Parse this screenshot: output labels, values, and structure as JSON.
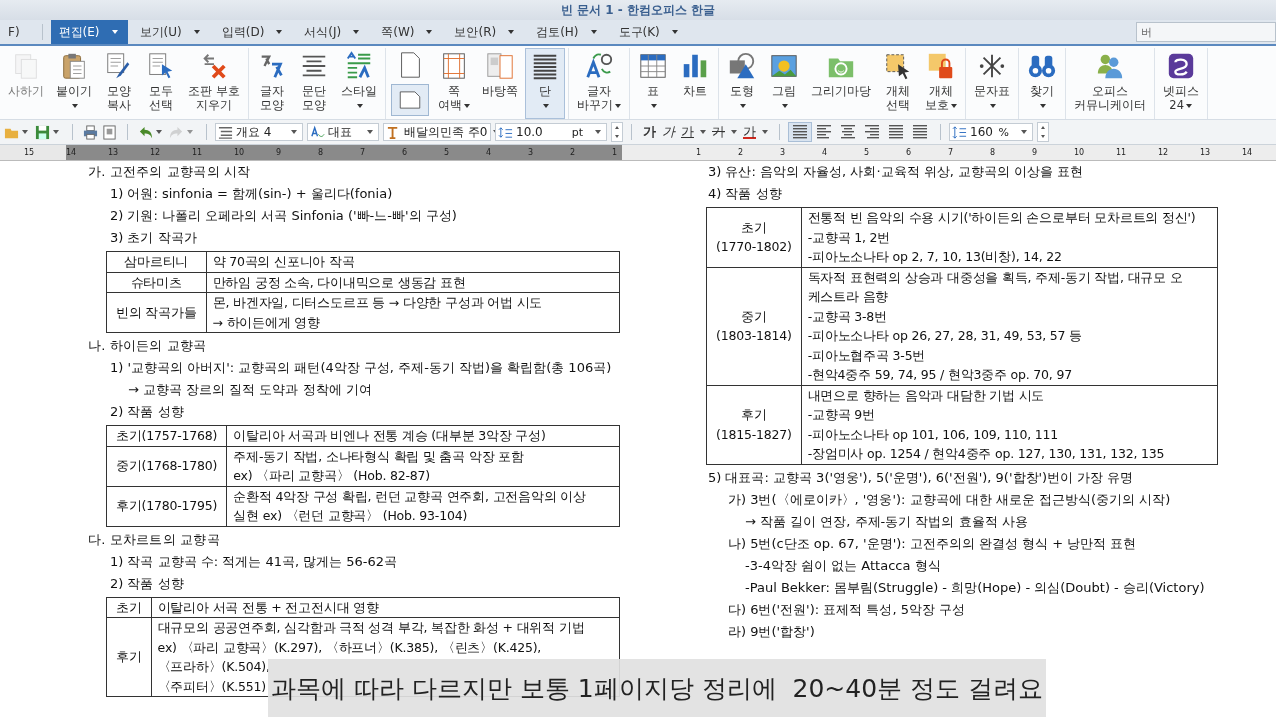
{
  "window": {
    "title": "빈 문서 1 - 한컴오피스 한글"
  },
  "menu_tabs": [
    {
      "label": "F)",
      "selected": false,
      "dropdown": false
    },
    {
      "label": "편집(E)",
      "selected": true,
      "dropdown": true
    },
    {
      "label": "보기(U)",
      "selected": false,
      "dropdown": true
    },
    {
      "label": "입력(D)",
      "selected": false,
      "dropdown": true
    },
    {
      "label": "서식(J)",
      "selected": false,
      "dropdown": true
    },
    {
      "label": "쪽(W)",
      "selected": false,
      "dropdown": true
    },
    {
      "label": "보안(R)",
      "selected": false,
      "dropdown": true
    },
    {
      "label": "검토(H)",
      "selected": false,
      "dropdown": true
    },
    {
      "label": "도구(K)",
      "selected": false,
      "dropdown": true
    }
  ],
  "search": {
    "value": "버"
  },
  "ribbon": [
    {
      "buttons": [
        {
          "kind": "copy",
          "label_lines": [
            "사하기"
          ],
          "selected": false,
          "disabled": true,
          "dropdown": false
        },
        {
          "kind": "paste",
          "label_lines": [
            "붙이기"
          ],
          "selected": false,
          "disabled": false,
          "dropdown": true
        },
        {
          "kind": "painter",
          "label_lines": [
            "모양",
            "복사"
          ],
          "selected": false,
          "disabled": false,
          "dropdown": false
        },
        {
          "kind": "select-all",
          "label_lines": [
            "모두",
            "선택"
          ],
          "selected": false,
          "disabled": false,
          "dropdown": false
        },
        {
          "kind": "clear-codes",
          "label_lines": [
            "조판 부호",
            "지우기"
          ],
          "selected": false,
          "disabled": false,
          "dropdown": false
        }
      ]
    },
    {
      "buttons": [
        {
          "kind": "char-shape",
          "label_lines": [
            "글자",
            "모양"
          ],
          "selected": false,
          "disabled": false,
          "dropdown": false
        },
        {
          "kind": "para-shape",
          "label_lines": [
            "문단",
            "모양"
          ],
          "selected": false,
          "disabled": false,
          "dropdown": false
        },
        {
          "kind": "style",
          "label_lines": [
            "스타일"
          ],
          "selected": false,
          "disabled": false,
          "dropdown": true
        }
      ]
    },
    {
      "buttons": [
        {
          "kind": "page-stack",
          "selected": true,
          "disabled": false
        },
        {
          "kind": "margin",
          "label_lines": [
            "쪽",
            "여백"
          ],
          "selected": false,
          "disabled": false,
          "dropdown": true
        },
        {
          "kind": "master-page",
          "label_lines": [
            "바탕쪽"
          ],
          "selected": false,
          "disabled": false,
          "dropdown": false
        },
        {
          "kind": "columns",
          "label_lines": [
            "단"
          ],
          "selected": true,
          "disabled": false,
          "dropdown": true
        }
      ]
    },
    {
      "buttons": [
        {
          "kind": "replace",
          "label_lines": [
            "글자",
            "바꾸기"
          ],
          "selected": false,
          "disabled": false,
          "dropdown": true
        }
      ]
    },
    {
      "buttons": [
        {
          "kind": "table",
          "label_lines": [
            "표"
          ],
          "selected": false,
          "disabled": false,
          "dropdown": true
        },
        {
          "kind": "chart",
          "label_lines": [
            "차트"
          ],
          "selected": false,
          "disabled": false,
          "dropdown": false
        }
      ]
    },
    {
      "buttons": [
        {
          "kind": "shape",
          "label_lines": [
            "도형"
          ],
          "selected": false,
          "disabled": false,
          "dropdown": true
        },
        {
          "kind": "picture",
          "label_lines": [
            "그림"
          ],
          "selected": false,
          "disabled": false,
          "dropdown": true
        },
        {
          "kind": "gallery",
          "label_lines": [
            "그리기마당"
          ],
          "selected": false,
          "disabled": false,
          "dropdown": false
        },
        {
          "kind": "object-select",
          "label_lines": [
            "개체",
            "선택"
          ],
          "selected": false,
          "disabled": false,
          "dropdown": false
        },
        {
          "kind": "object-protect",
          "label_lines": [
            "개체",
            "보호"
          ],
          "selected": false,
          "disabled": false,
          "dropdown": true
        }
      ]
    },
    {
      "buttons": [
        {
          "kind": "symbol",
          "label_lines": [
            "문자표"
          ],
          "selected": false,
          "disabled": false,
          "dropdown": true
        }
      ]
    },
    {
      "buttons": [
        {
          "kind": "find",
          "label_lines": [
            "찾기"
          ],
          "selected": false,
          "disabled": false,
          "dropdown": true
        }
      ]
    },
    {
      "buttons": [
        {
          "kind": "communicator",
          "label_lines": [
            "오피스",
            "커뮤니케이터"
          ],
          "selected": false,
          "disabled": false,
          "dropdown": false
        }
      ]
    },
    {
      "buttons": [
        {
          "kind": "netffice",
          "label_lines": [
            "넷피스",
            "24"
          ],
          "selected": false,
          "disabled": false,
          "dropdown": true
        }
      ]
    }
  ],
  "toolbar": {
    "file_buttons": [
      {
        "kind": "open",
        "dropdown": true,
        "disabled": false
      },
      {
        "kind": "save",
        "dropdown": true,
        "disabled": false
      },
      {
        "kind": "print",
        "dropdown": false,
        "disabled": false
      },
      {
        "kind": "preview",
        "dropdown": false,
        "disabled": false
      },
      {
        "kind": "undo",
        "dropdown": true,
        "disabled": false
      },
      {
        "kind": "redo",
        "dropdown": true,
        "disabled": true
      }
    ],
    "style_box": {
      "value": "개요 4"
    },
    "language_box": {
      "value": "대표"
    },
    "font_box": {
      "value": "배달의민족 주0"
    },
    "size_box": {
      "value": "10.0",
      "unit": "pt"
    },
    "format_buttons": [
      {
        "label": "가",
        "kind": "bold",
        "dropdown": false
      },
      {
        "label": "가",
        "kind": "italic",
        "dropdown": false
      },
      {
        "label": "가",
        "kind": "underline",
        "dropdown": true
      },
      {
        "label": "가",
        "kind": "strike",
        "dropdown": true
      },
      {
        "label": "가",
        "kind": "color",
        "dropdown": true
      }
    ],
    "align_buttons": [
      {
        "kind": "justify",
        "selected": true
      },
      {
        "kind": "left",
        "selected": false
      },
      {
        "kind": "center",
        "selected": false
      },
      {
        "kind": "right",
        "selected": false
      },
      {
        "kind": "distribute",
        "selected": false
      },
      {
        "kind": "divide",
        "selected": false
      }
    ],
    "spacing_box": {
      "value": "160",
      "unit": "%"
    }
  },
  "ruler": {
    "left_labels": [
      "15",
      "14",
      "13",
      "12",
      "11",
      "10",
      "9",
      "8",
      "7",
      "6",
      "5",
      "4",
      "3",
      "2",
      "1"
    ],
    "right_labels": [
      "1",
      "2",
      "3",
      "4",
      "5",
      "6",
      "7",
      "8",
      "9",
      "10",
      "11",
      "12",
      "13",
      "14"
    ]
  },
  "document": {
    "columns": [
      {
        "items": [
          {
            "kind": "heading",
            "text": "가. 고전주의 교향곡의 시작",
            "children": [
              {
                "kind": "item",
                "text": "1) 어원: sinfonia = 함께(sin-) + 울리다(fonia)"
              },
              {
                "kind": "item",
                "text": "2) 기원: 나폴리 오페라의 서곡 Sinfonia ('빠-느-빠'의 구성)"
              },
              {
                "kind": "item",
                "text": "3) 초기 작곡가",
                "children": [
                  {
                    "kind": "table",
                    "rows": [
                      {
                        "label_lines": [
                          "삼마르티니"
                        ],
                        "lines": [
                          "약 70곡의 신포니아 작곡"
                        ]
                      },
                      {
                        "label_lines": [
                          "슈타미츠"
                        ],
                        "lines": [
                          "만하임 궁정 소속, 다이내믹으로 생동감 표현"
                        ]
                      },
                      {
                        "label_lines": [
                          "빈의 작곡가들"
                        ],
                        "lines": [
                          "몬, 바겐자일, 디터스도르프 등 → 다양한 구성과 어법 시도",
                          "→ 하이든에게 영향"
                        ]
                      }
                    ]
                  }
                ]
              }
            ]
          },
          {
            "kind": "heading",
            "text": "나. 하이든의 교향곡",
            "children": [
              {
                "kind": "item",
                "text": "1) '교향곡의 아버지': 교향곡의 패턴(4악장 구성, 주제-동기 작법)을 확립함(총 106곡)",
                "children": [
                  {
                    "kind": "item",
                    "text": "→ 교향곡 장르의 질적 도약과 정착에 기여"
                  }
                ]
              },
              {
                "kind": "item",
                "text": "2) 작품 성향",
                "children": [
                  {
                    "kind": "table",
                    "rows": [
                      {
                        "label_lines": [
                          "초기(1757-1768)"
                        ],
                        "lines": [
                          "이탈리아 서곡과 비엔나 전통 계승 (대부분 3악장 구성)"
                        ]
                      },
                      {
                        "label_lines": [
                          "중기(1768-1780)"
                        ],
                        "lines": [
                          "주제-동기 작법, 소나타형식 확립 및 춤곡 악장 포함",
                          "ex) 〈파리 교향곡〉 (Hob. 82-87)"
                        ]
                      },
                      {
                        "label_lines": [
                          "후기(1780-1795)"
                        ],
                        "lines": [
                          "순환적 4악장 구성 확립, 런던 교향곡 연주회, 고전음악의 이상",
                          "실현 ex) 〈런던 교향곡〉 (Hob. 93-104)"
                        ]
                      }
                    ]
                  }
                ]
              }
            ]
          },
          {
            "kind": "heading",
            "text": "다. 모차르트의 교향곡",
            "children": [
              {
                "kind": "item",
                "text": "1) 작곡 교향곡 수: 적게는 41곡, 많게는 56-62곡"
              },
              {
                "kind": "item",
                "text": "2) 작품 성향",
                "children": [
                  {
                    "kind": "table",
                    "rows": [
                      {
                        "label_lines": [
                          "초기"
                        ],
                        "lines": [
                          "이탈리아 서곡 전통 + 전고전시대 영향"
                        ]
                      },
                      {
                        "label_lines": [
                          "후기"
                        ],
                        "lines": [
                          "대규모의 공공연주회, 심각함과 극적 성격 부각, 복잡한 화성 + 대위적 기법",
                          "ex) 〈파리 교향곡〉(K.297), 〈하프너〉(K.385), 〈린츠〉(K.425),",
                          "〈프라하〉(K.504),",
                          "〈주피터〉(K.551)"
                        ]
                      }
                    ]
                  }
                ]
              }
            ]
          }
        ]
      },
      {
        "items": [
          {
            "kind": "item",
            "text": "3) 유산: 음악의 자율성, 사회·교육적 위상, 교향곡의 이상을 표현"
          },
          {
            "kind": "item",
            "text": "4) 작품 성향",
            "children": [
              {
                "kind": "table",
                "rows": [
                  {
                    "label_lines": [
                      "초기",
                      "(1770-1802)"
                    ],
                    "lines": [
                      "전통적 빈 음악의 수용 시기('하이든의 손으로부터 모차르트의 정신')",
                      "-교향곡 1, 2번",
                      "-피아노소나타 op 2, 7, 10, 13(비창), 14, 22"
                    ]
                  },
                  {
                    "label_lines": [
                      "중기",
                      "(1803-1814)"
                    ],
                    "lines": [
                      "독자적 표현력의 상승과 대중성을 획득, 주제-동기 작법, 대규모 오",
                      "케스트라 음향",
                      "-교향곡 3-8번",
                      "-피아노소나타 op 26, 27, 28, 31, 49, 53, 57 등",
                      "-피아노협주곡 3-5번",
                      "-현악4중주 59, 74, 95 / 현악3중주 op. 70, 97"
                    ]
                  },
                  {
                    "label_lines": [
                      "후기",
                      "(1815-1827)"
                    ],
                    "lines": [
                      "내면으로 향하는 음악과 대담한 기법 시도",
                      "-교향곡 9번",
                      "-피아노소나타 op 101, 106, 109, 110, 111",
                      "-장엄미사 op. 1254 / 현악4중주 op. 127, 130, 131, 132, 135"
                    ]
                  }
                ]
              }
            ]
          },
          {
            "kind": "item",
            "text": "5) 대표곡: 교향곡 3('영웅'), 5('운명'), 6('전원'), 9('합창')번이 가장 유명",
            "children": [
              {
                "kind": "item",
                "text": "가) 3번(〈에로이카〉, '영웅'): 교향곡에 대한 새로운 접근방식(중기의 시작)",
                "children": [
                  {
                    "kind": "item",
                    "text": "→ 작품 길이 연장, 주제-동기 작법의 효율적 사용"
                  }
                ]
              },
              {
                "kind": "item",
                "text": "나) 5번(c단조 op. 67, '운명'): 고전주의의 완결성 형식 + 낭만적 표현",
                "children": [
                  {
                    "kind": "item",
                    "text": "-3-4악장 쉼이 없는 Attacca 형식"
                  },
                  {
                    "kind": "item",
                    "text": "-Paul Bekker: 몸부림(Struggle) - 희망(Hope) - 의심(Doubt) - 승리(Victory)"
                  }
                ]
              },
              {
                "kind": "item",
                "text": "다) 6번('전원'): 표제적 특성, 5악장 구성"
              },
              {
                "kind": "item",
                "text": "라) 9번('합창')"
              }
            ]
          }
        ]
      }
    ]
  },
  "subtitle": "과목에 따라 다르지만 보통 1페이지당 정리에  20~40분 정도 걸려요"
}
